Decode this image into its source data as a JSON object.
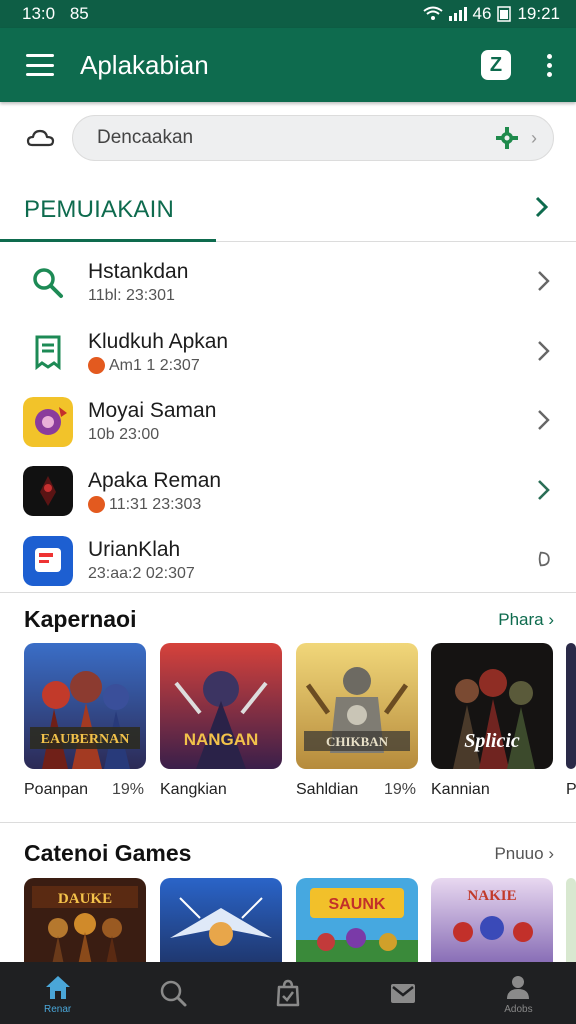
{
  "status_bar": {
    "time": "13:0",
    "left_extra": "85",
    "signal_text": "46",
    "battery_time": "19:21"
  },
  "app_bar": {
    "title": "Aplakabian",
    "action_letter": "Z"
  },
  "search": {
    "placeholder": "Dencaakan"
  },
  "section": {
    "title": "PEMUIAKAIN"
  },
  "list": [
    {
      "title": "Hstankdan",
      "subtitle": "11bl: 23:301",
      "icon": "search-icon",
      "has_badge": false
    },
    {
      "title": "Kludkuh Apkan",
      "subtitle": "Am1 1 2:307",
      "icon": "receipt-icon",
      "has_badge": true
    },
    {
      "title": "Moyai Saman",
      "subtitle": "10b 23:00",
      "icon": "app-icon-yellow",
      "has_badge": false
    },
    {
      "title": "Apaka Reman",
      "subtitle": "11:31 23:303",
      "icon": "app-icon-dark",
      "has_badge": true
    },
    {
      "title": "UrianKlah",
      "subtitle": "23:aa:2 02:307",
      "icon": "app-icon-blue",
      "has_badge": false
    }
  ],
  "carousel1": {
    "title": "Kapernaoi",
    "more": "Phara",
    "cards": [
      {
        "name": "Poanpan",
        "pct": "19%",
        "art": "EAUBERNAN"
      },
      {
        "name": "Kangkian",
        "pct": "",
        "art": "NANGAN"
      },
      {
        "name": "Sahldian",
        "pct": "19%",
        "art": "CHIKBAN"
      },
      {
        "name": "Kannian",
        "pct": "",
        "art": "Splicic"
      },
      {
        "name": "P",
        "pct": "",
        "art": ""
      }
    ]
  },
  "carousel2": {
    "title": "Catenoi Games",
    "more": "Pnuuo",
    "cards": [
      {
        "art": "DAUKE"
      },
      {
        "art": ""
      },
      {
        "art": "SAUNK"
      },
      {
        "art": "NAKIE"
      }
    ]
  },
  "bottom_nav": [
    {
      "label": "Renar",
      "icon": "home-icon",
      "active": true
    },
    {
      "label": "",
      "icon": "search-icon",
      "active": false
    },
    {
      "label": "",
      "icon": "check-bag-icon",
      "active": false
    },
    {
      "label": "",
      "icon": "mail-icon",
      "active": false
    },
    {
      "label": "Adobs",
      "icon": "person-icon",
      "active": false
    }
  ],
  "colors": {
    "primary": "#0e6b4e",
    "status_bar": "#0e5e45",
    "nav_bg": "#1f2022",
    "nav_active": "#4aa6d8"
  }
}
